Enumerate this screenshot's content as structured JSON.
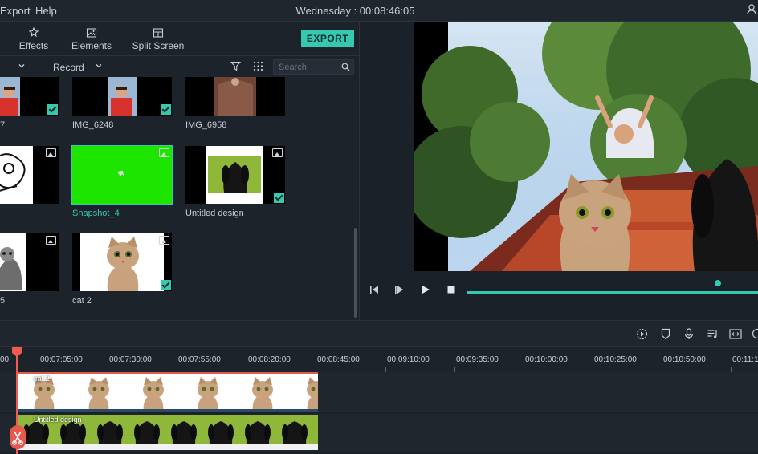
{
  "menu": {
    "export": "Export",
    "help": "Help",
    "clock": "Wednesday : 00:08:46:05"
  },
  "tabs": {
    "effects": "Effects",
    "elements": "Elements",
    "split_screen": "Split Screen",
    "export_button": "EXPORT"
  },
  "filter": {
    "record": "Record",
    "search_placeholder": "Search"
  },
  "media": {
    "captions": {
      "r1c1": "7",
      "r1c2": "IMG_6248",
      "r1c3": "IMG_6958",
      "r2c2": "Snapshot_4",
      "r2c3": "Untitled design",
      "r3c1": "5",
      "r3c2": "cat 2"
    }
  },
  "ruler": {
    "labels": [
      "00",
      "00:07:05:00",
      "00:07:30:00",
      "00:07:55:00",
      "00:08:20:00",
      "00:08:45:00",
      "00:09:10:00",
      "00:09:35:00",
      "00:10:00:00",
      "00:10:25:00",
      "00:10:50:00",
      "00:11:1"
    ]
  },
  "tracks": {
    "clip1": "cat 2",
    "clip2": "Untitled design"
  },
  "colors": {
    "accent": "#35c9b1",
    "playhead": "#f05a4f",
    "green_screen": "#1de500"
  }
}
